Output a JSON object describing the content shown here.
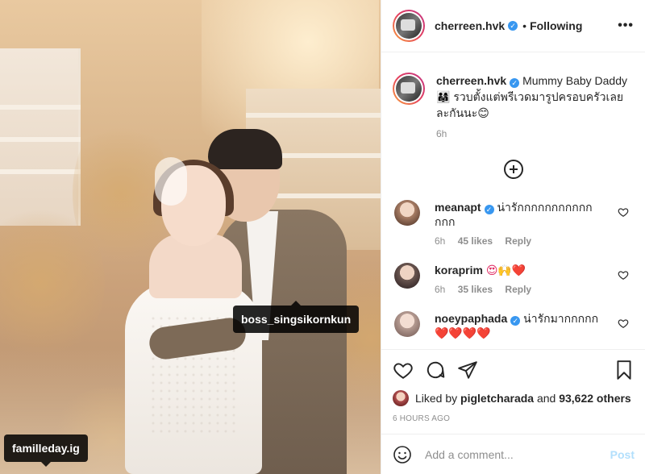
{
  "photo": {
    "tags": [
      {
        "label": "boss_singsikornkun"
      },
      {
        "label": "familleday.ig"
      }
    ]
  },
  "header": {
    "username": "cherreen.hvk",
    "separator": "•",
    "follow_status": "Following",
    "more_label": "•••"
  },
  "caption": {
    "username": "cherreen.hvk",
    "text_line1": "Mummy Baby Daddy",
    "text_line2": "👨‍👩‍👧 รวบตั้งแต่พรีเวดมารูปครอบครัวเลยละกันนะ😊",
    "time": "6h"
  },
  "comments": [
    {
      "username": "meanapt",
      "text": "น่ารักกกกกกกกกกกกกก",
      "time": "6h",
      "likes": "45 likes",
      "reply": "Reply",
      "avatar_color": "#caa088"
    },
    {
      "username": "koraprim",
      "text": "😍🙌❤️",
      "time": "6h",
      "likes": "35 likes",
      "reply": "Reply",
      "avatar_color": "#7c6a64"
    },
    {
      "username": "noeypaphada",
      "text": "น่ารักมากกกกก",
      "text2": "❤️❤️❤️❤️",
      "avatar_color": "#d9c4bd"
    }
  ],
  "likes": {
    "prefix": "Liked by",
    "user": "pigletcharada",
    "conjunction": "and",
    "others": "93,622 others"
  },
  "timestamp": "6 HOURS AGO",
  "add_comment": {
    "placeholder": "Add a comment...",
    "post_label": "Post"
  },
  "colors": {
    "verified": "#3897f0",
    "heart": "#e0245e",
    "post_disabled": "#b2dffc"
  }
}
